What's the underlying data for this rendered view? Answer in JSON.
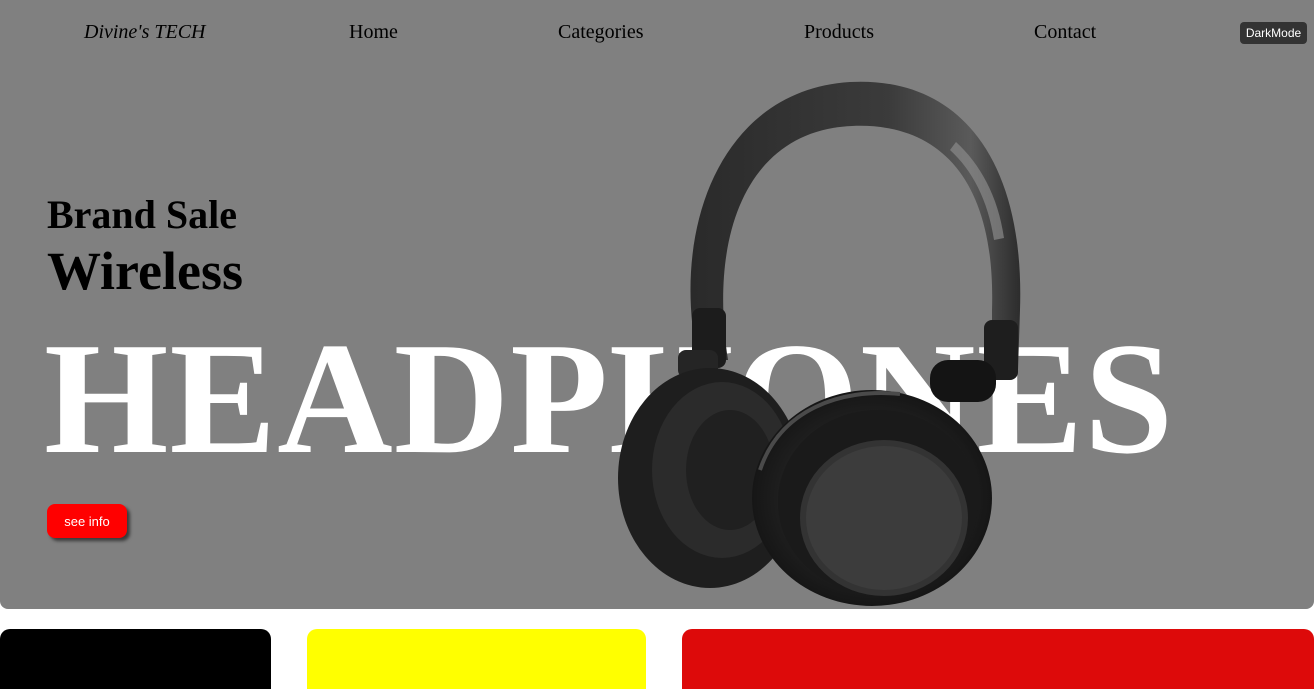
{
  "header": {
    "brand": "Divine's TECH",
    "nav": {
      "home": "Home",
      "categories": "Categories",
      "products": "Products",
      "contact": "Contact"
    },
    "dark_mode_label": "DarkMode"
  },
  "hero": {
    "line1": "Brand Sale",
    "line2": "Wireless",
    "big_title": "HEADPHONES",
    "cta_label": "see info",
    "background_color": "#808080",
    "cta_color": "#ff0000",
    "image": "black over-ear headphones"
  },
  "cards": {
    "colors": [
      "#000000",
      "#ffff00",
      "#dd0a0a"
    ]
  }
}
